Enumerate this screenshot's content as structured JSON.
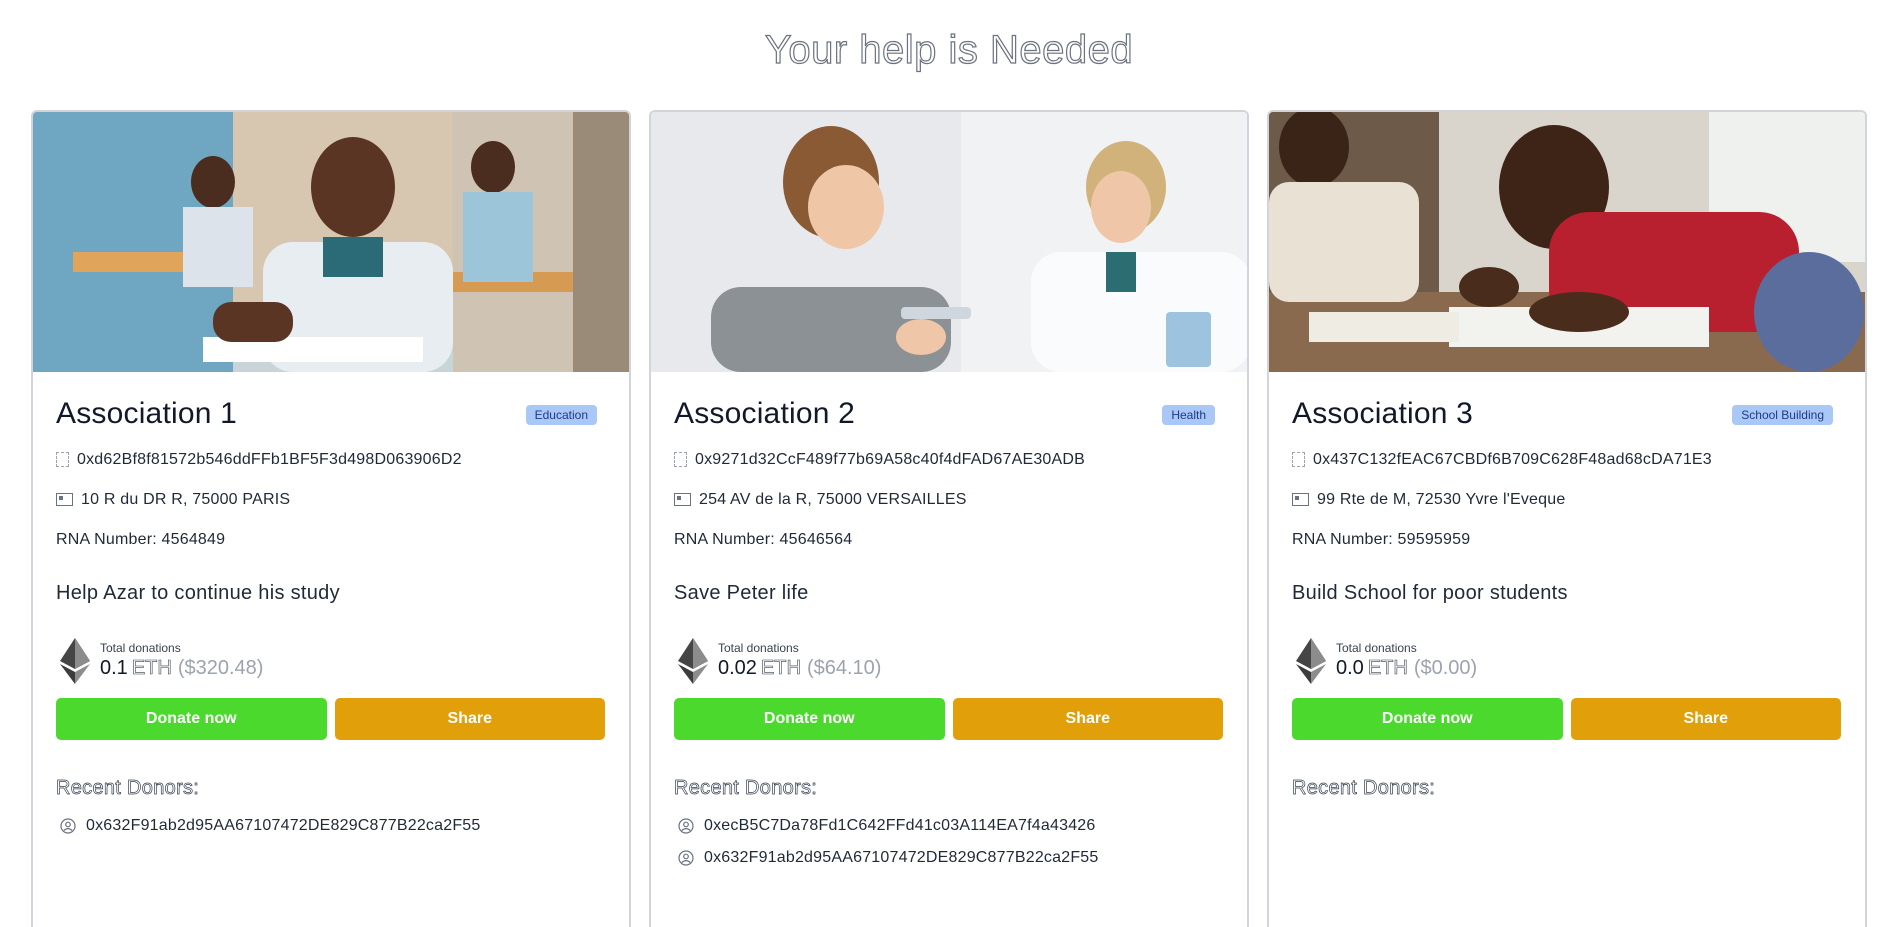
{
  "page": {
    "title": "Your help is Needed"
  },
  "cards": [
    {
      "title": "Association 1",
      "category": "Education",
      "wallet": "0xd62Bf8f81572b546ddFFb1BF5F3d498D063906D2",
      "address": "10 R du DR R, 75000 PARIS",
      "rna": "RNA Number: 4564849",
      "campaign": "Help Azar to continue his study",
      "donations_label": "Total donations",
      "donations_eth": "0.1",
      "eth_unit": "ETH",
      "donations_usd": "($320.48)",
      "donate_label": "Donate now",
      "share_label": "Share",
      "recent_label": "Recent Donors:",
      "donors": [
        "0x632F91ab2d95AA67107472DE829C877B22ca2F55"
      ]
    },
    {
      "title": "Association 2",
      "category": "Health",
      "wallet": "0x9271d32CcF489f77b69A58c40f4dFAD67AE30ADB",
      "address": "254 AV de la R, 75000 VERSAILLES",
      "rna": "RNA Number: 45646564",
      "campaign": "Save Peter life",
      "donations_label": "Total donations",
      "donations_eth": "0.02",
      "eth_unit": "ETH",
      "donations_usd": "($64.10)",
      "donate_label": "Donate now",
      "share_label": "Share",
      "recent_label": "Recent Donors:",
      "donors": [
        "0xecB5C7Da78Fd1C642FFd41c03A114EA7f4a43426",
        "0x632F91ab2d95AA67107472DE829C877B22ca2F55"
      ]
    },
    {
      "title": "Association 3",
      "category": "School Building",
      "wallet": "0x437C132fEAC67CBDf6B709C628F48ad68cDA71E3",
      "address": "99 Rte de M, 72530 Yvre l'Eveque",
      "rna": "RNA Number: 59595959",
      "campaign": "Build School for poor students",
      "donations_label": "Total donations",
      "donations_eth": "0.0",
      "eth_unit": "ETH",
      "donations_usd": "($0.00)",
      "donate_label": "Donate now",
      "share_label": "Share",
      "recent_label": "Recent Donors:",
      "donors": []
    }
  ],
  "icons": {
    "wallet": "wallet-icon",
    "address": "id-card-icon",
    "currency": "ethereum-icon",
    "donor": "user-circle-icon"
  },
  "colors": {
    "donate": "#4cd92e",
    "share": "#e19f0a",
    "badge": "#a9c8f5"
  }
}
